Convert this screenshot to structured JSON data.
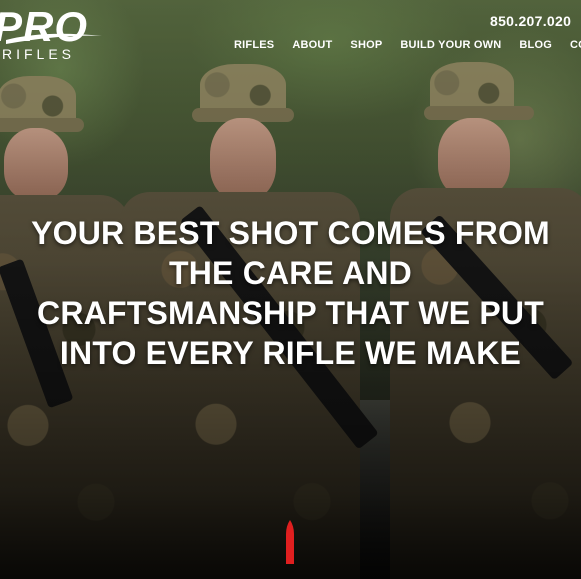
{
  "brand": {
    "logo_main": "PRO",
    "logo_sub": "RIFLES"
  },
  "header": {
    "phone": "850.207.020"
  },
  "nav": {
    "items": [
      {
        "label": "RIFLES"
      },
      {
        "label": "ABOUT"
      },
      {
        "label": "SHOP"
      },
      {
        "label": "BUILD YOUR OWN"
      },
      {
        "label": "BLOG"
      },
      {
        "label": "CONT"
      }
    ]
  },
  "hero": {
    "headline_lines": [
      "YOUR BEST SHOT COMES FROM",
      "THE CARE AND",
      "CRAFTSMANSHIP THAT WE PUT",
      "INTO EVERY RIFLE WE MAKE"
    ],
    "scroll_indicator_icon": "bullet-icon"
  },
  "colors": {
    "text": "#ffffff",
    "accent": "#e01f1f"
  }
}
